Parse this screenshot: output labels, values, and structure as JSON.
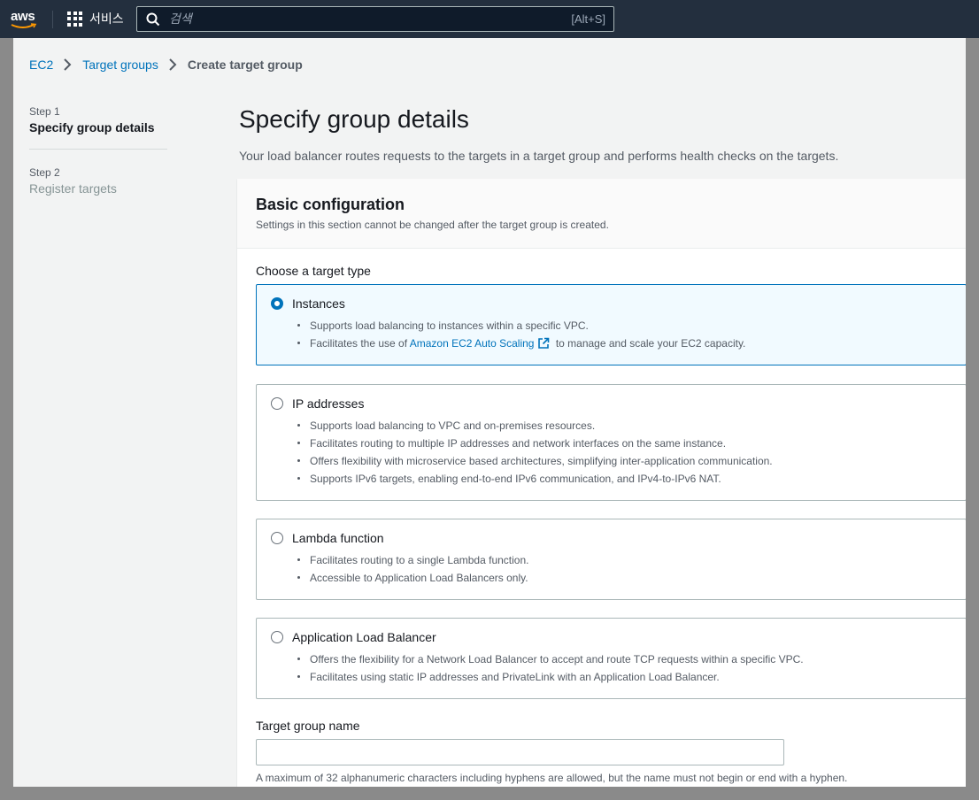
{
  "topnav": {
    "logo_text": "aws",
    "services_label": "서비스",
    "search_placeholder": "검색",
    "search_shortcut": "[Alt+S]"
  },
  "breadcrumb": {
    "items": [
      "EC2",
      "Target groups"
    ],
    "current": "Create target group"
  },
  "steps": [
    {
      "label": "Step 1",
      "title": "Specify group details",
      "active": true
    },
    {
      "label": "Step 2",
      "title": "Register targets",
      "active": false
    }
  ],
  "main": {
    "title": "Specify group details",
    "description": "Your load balancer routes requests to the targets in a target group and performs health checks on the targets."
  },
  "basic_config": {
    "title": "Basic configuration",
    "subtitle": "Settings in this section cannot be changed after the target group is created.",
    "target_type_label": "Choose a target type",
    "target_types": [
      {
        "title": "Instances",
        "selected": true,
        "bullets": [
          "Supports load balancing to instances within a specific VPC.",
          {
            "prefix": "Facilitates the use of ",
            "link": "Amazon EC2 Auto Scaling",
            "suffix": " to manage and scale your EC2 capacity."
          }
        ]
      },
      {
        "title": "IP addresses",
        "selected": false,
        "bullets": [
          "Supports load balancing to VPC and on-premises resources.",
          "Facilitates routing to multiple IP addresses and network interfaces on the same instance.",
          "Offers flexibility with microservice based architectures, simplifying inter-application communication.",
          "Supports IPv6 targets, enabling end-to-end IPv6 communication, and IPv4-to-IPv6 NAT."
        ]
      },
      {
        "title": "Lambda function",
        "selected": false,
        "bullets": [
          "Facilitates routing to a single Lambda function.",
          "Accessible to Application Load Balancers only."
        ]
      },
      {
        "title": "Application Load Balancer",
        "selected": false,
        "bullets": [
          "Offers the flexibility for a Network Load Balancer to accept and route TCP requests within a specific VPC.",
          "Facilitates using static IP addresses and PrivateLink with an Application Load Balancer."
        ]
      }
    ],
    "target_group_name": {
      "label": "Target group name",
      "value": "",
      "hint": "A maximum of 32 alphanumeric characters including hyphens are allowed, but the name must not begin or end with a hyphen."
    }
  },
  "colors": {
    "nav_bg": "#232f3e",
    "link": "#0073bb",
    "selected_tile_bg": "#f1faff",
    "page_bg": "#f2f3f3"
  }
}
